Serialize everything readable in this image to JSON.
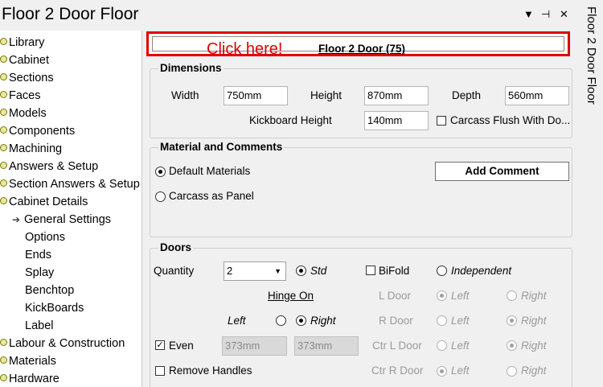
{
  "title": "Floor 2 Door Floor",
  "title_buttons": {
    "dropdown": "▼",
    "pin": "⊣",
    "close": "✕"
  },
  "side_tab": "Floor 2 Door Floor",
  "tree": {
    "items": [
      "Library",
      "Cabinet",
      "Sections",
      "Faces",
      "Models",
      "Components",
      "Machining",
      "Answers & Setup",
      "Section Answers & Setup",
      "Cabinet Details"
    ],
    "subitems": [
      "General Settings",
      "Options",
      "Ends",
      "Splay",
      "Benchtop",
      "KickBoards",
      "Label"
    ],
    "items2": [
      "Labour & Construction",
      "Materials",
      "Hardware"
    ]
  },
  "banner": {
    "click_text": "Click here!",
    "link": "Floor 2 Door (75)"
  },
  "dimensions": {
    "title": "Dimensions",
    "width_label": "Width",
    "width": "750mm",
    "height_label": "Height",
    "height": "870mm",
    "depth_label": "Depth",
    "depth": "560mm",
    "kick_label": "Kickboard Height",
    "kick": "140mm",
    "flush_label": "Carcass Flush With Do..."
  },
  "material": {
    "title": "Material and Comments",
    "default_label": "Default Materials",
    "panel_label": "Carcass as Panel",
    "add_comment": "Add Comment"
  },
  "doors": {
    "title": "Doors",
    "quantity_label": "Quantity",
    "quantity": "2",
    "std_label": "Std",
    "bifold_label": "BiFold",
    "independent_label": "Independent",
    "hinge_label": "Hinge On",
    "left_label": "Left",
    "right_label": "Right",
    "even_label": "Even",
    "even_left": "373mm",
    "even_right": "373mm",
    "remove_label": "Remove Handles",
    "ldoor": "L Door",
    "rdoor": "R Door",
    "ctrl": "Ctr L Door",
    "ctrr": "Ctr R Door",
    "opt_left": "Left",
    "opt_right": "Right"
  }
}
